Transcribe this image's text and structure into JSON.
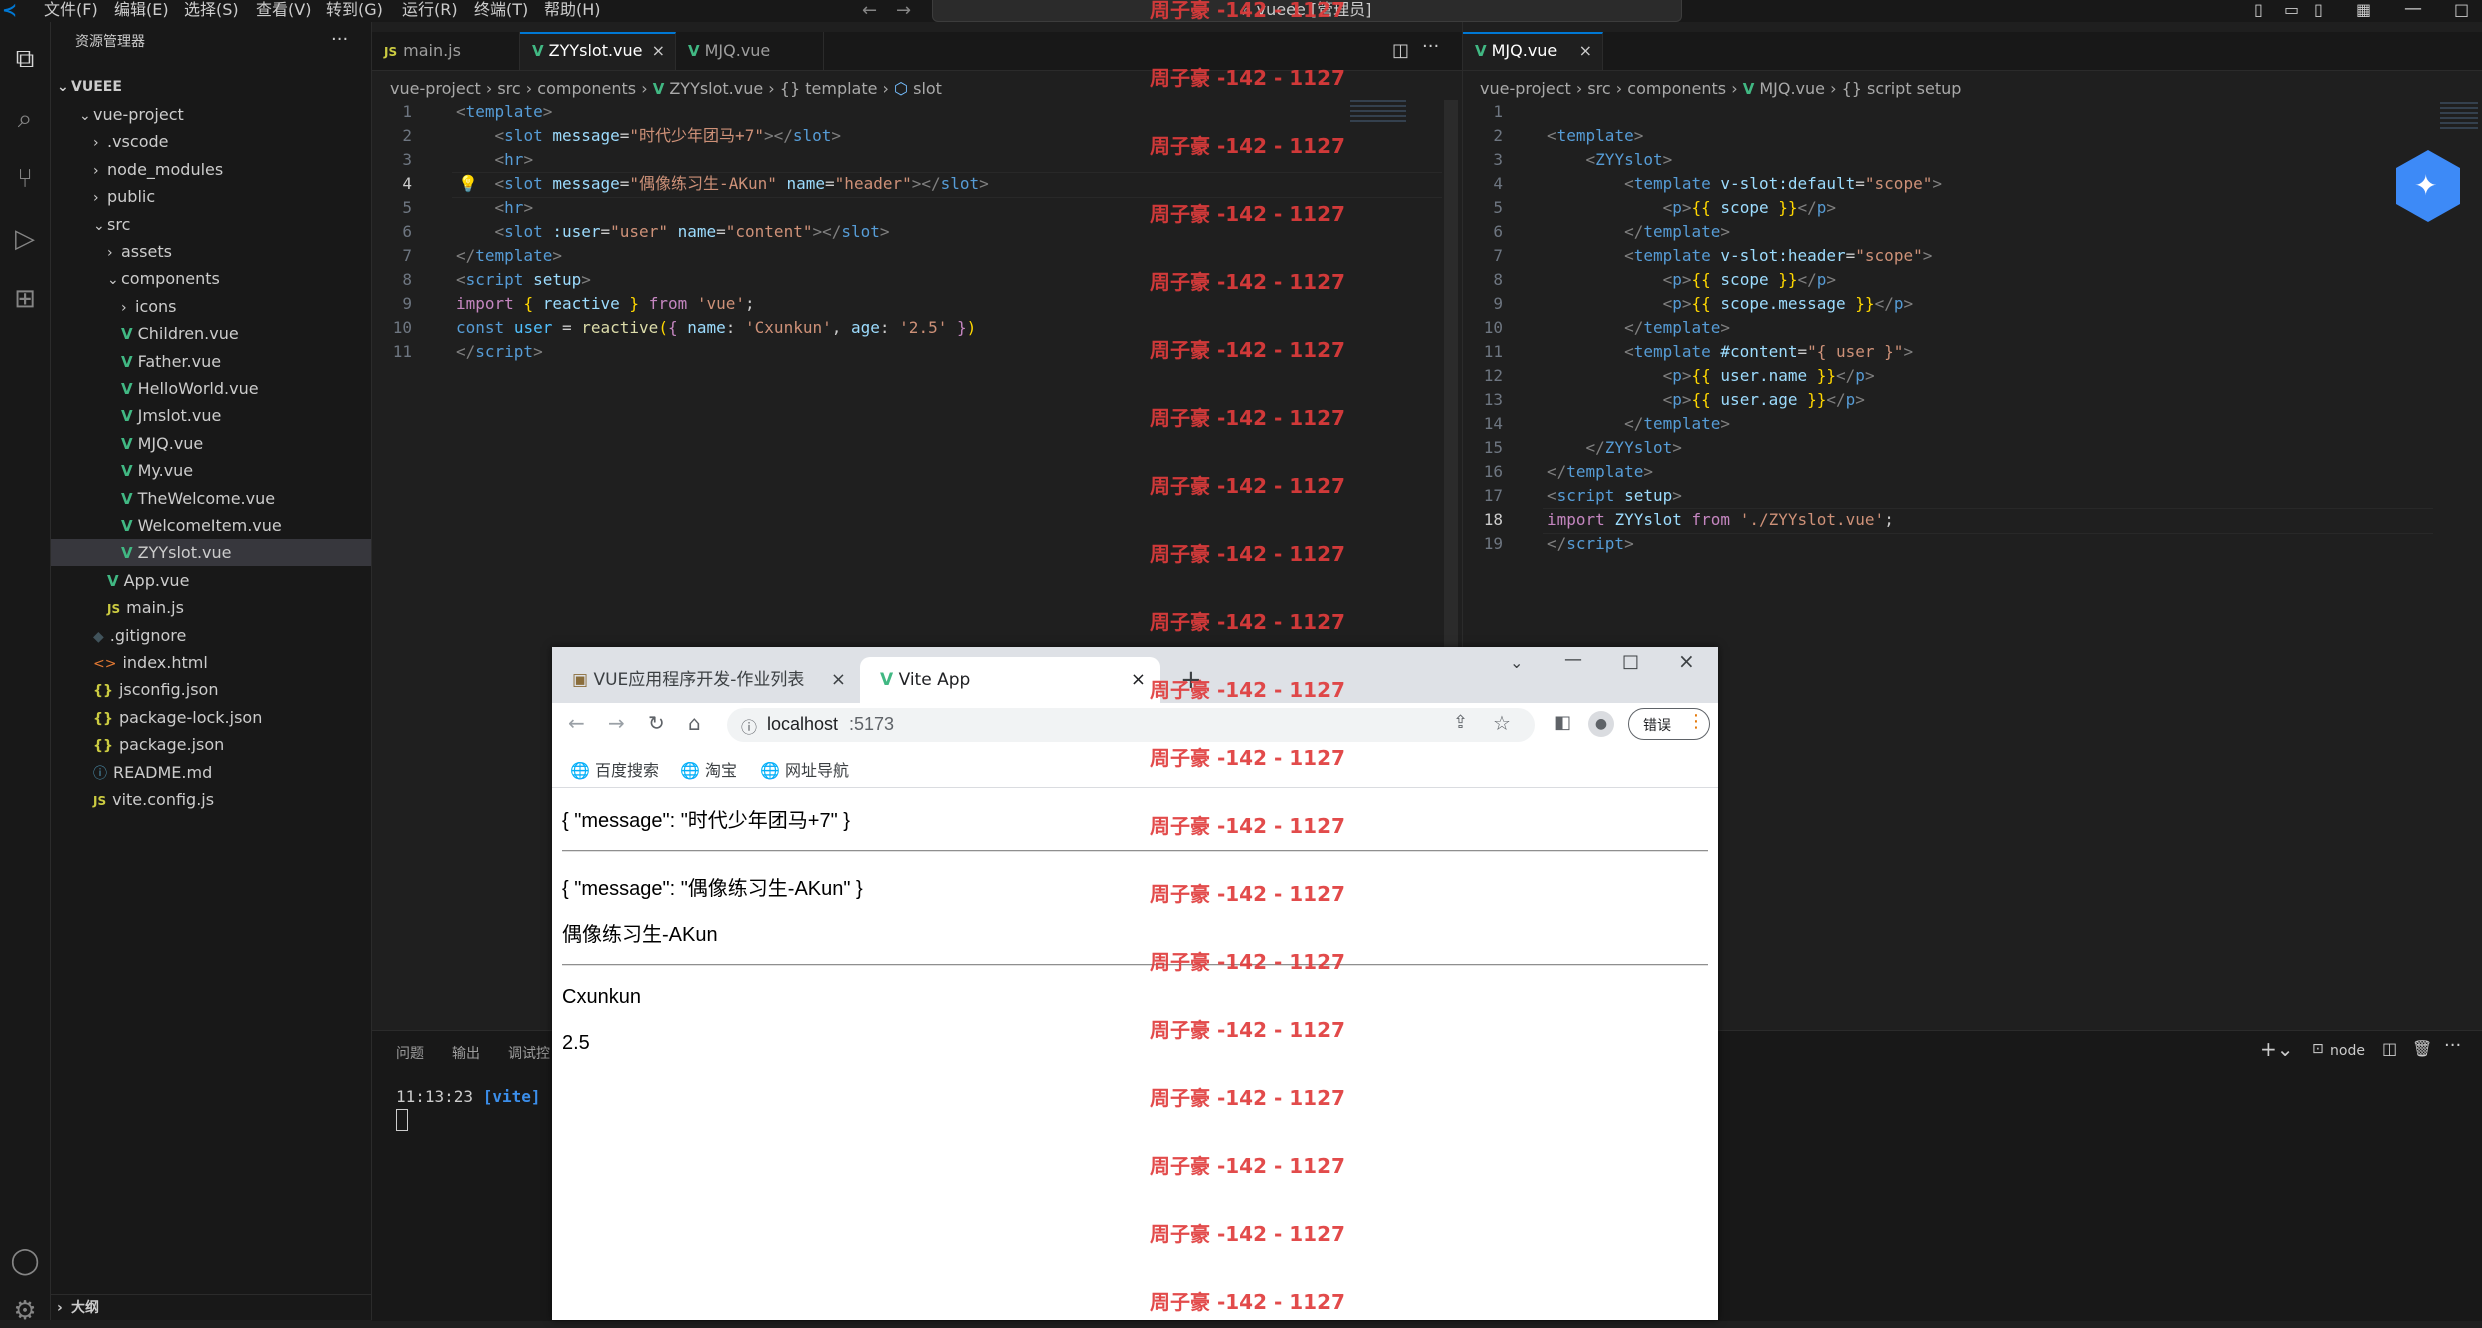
{
  "titlebar": {
    "menus": [
      "文件(F)",
      "编辑(E)",
      "选择(S)",
      "查看(V)",
      "转到(G)",
      "运行(R)",
      "终端(T)",
      "帮助(H)"
    ],
    "search_text": "vueee [管理员]"
  },
  "sidebar": {
    "header": "资源管理器",
    "root": "VUEEE",
    "items": [
      {
        "label": "vue-project",
        "kind": "folder-open",
        "depth": 1
      },
      {
        "label": ".vscode",
        "kind": "folder",
        "depth": 2
      },
      {
        "label": "node_modules",
        "kind": "folder",
        "depth": 2
      },
      {
        "label": "public",
        "kind": "folder",
        "depth": 2
      },
      {
        "label": "src",
        "kind": "folder-open",
        "depth": 2
      },
      {
        "label": "assets",
        "kind": "folder",
        "depth": 3
      },
      {
        "label": "components",
        "kind": "folder-open",
        "depth": 3
      },
      {
        "label": "icons",
        "kind": "folder",
        "depth": 4
      },
      {
        "label": "Children.vue",
        "kind": "vue",
        "depth": 4
      },
      {
        "label": "Father.vue",
        "kind": "vue",
        "depth": 4
      },
      {
        "label": "HelloWorld.vue",
        "kind": "vue",
        "depth": 4
      },
      {
        "label": "Jmslot.vue",
        "kind": "vue",
        "depth": 4
      },
      {
        "label": "MJQ.vue",
        "kind": "vue",
        "depth": 4
      },
      {
        "label": "My.vue",
        "kind": "vue",
        "depth": 4
      },
      {
        "label": "TheWelcome.vue",
        "kind": "vue",
        "depth": 4
      },
      {
        "label": "WelcomeItem.vue",
        "kind": "vue",
        "depth": 4
      },
      {
        "label": "ZYYslot.vue",
        "kind": "vue",
        "depth": 4,
        "selected": true
      },
      {
        "label": "App.vue",
        "kind": "vue",
        "depth": 3
      },
      {
        "label": "main.js",
        "kind": "js",
        "depth": 3
      },
      {
        "label": ".gitignore",
        "kind": "git",
        "depth": 2
      },
      {
        "label": "index.html",
        "kind": "html",
        "depth": 2
      },
      {
        "label": "jsconfig.json",
        "kind": "json",
        "depth": 2
      },
      {
        "label": "package-lock.json",
        "kind": "json",
        "depth": 2
      },
      {
        "label": "package.json",
        "kind": "json",
        "depth": 2
      },
      {
        "label": "README.md",
        "kind": "info",
        "depth": 2
      },
      {
        "label": "vite.config.js",
        "kind": "js",
        "depth": 2
      }
    ],
    "outline": "大纲"
  },
  "editor_left": {
    "tabs": [
      {
        "label": "main.js",
        "icon": "JS"
      },
      {
        "label": "ZYYslot.vue",
        "icon": "V",
        "active": true
      },
      {
        "label": "MJQ.vue",
        "icon": "V"
      }
    ],
    "breadcrumb": [
      "vue-project",
      "src",
      "components",
      "ZYYslot.vue",
      "{} template",
      "slot"
    ],
    "current_line": 4
  },
  "editor_right": {
    "tabs": [
      {
        "label": "MJQ.vue",
        "icon": "V",
        "active": true
      }
    ],
    "breadcrumb": [
      "vue-project",
      "src",
      "components",
      "MJQ.vue",
      "{} script setup"
    ],
    "current_line": 18
  },
  "panel": {
    "tabs": [
      "问题",
      "输出",
      "调试控"
    ],
    "terminal_time": "11:13:23",
    "terminal_tag": "[vite]",
    "terminal_rest": "(",
    "node_label": "node"
  },
  "browser": {
    "tabs": [
      {
        "label": "VUE应用程序开发-作业列表"
      },
      {
        "label": "Vite App",
        "active": true
      }
    ],
    "url_host": "localhost",
    "url_port": ":5173",
    "profile_button": "错误",
    "bookmarks": [
      "百度搜索",
      "淘宝",
      "网址导航"
    ],
    "content": {
      "line1": "{ \"message\": \"时代少年团马+7\" }",
      "line2": "{ \"message\": \"偶像练习生-AKun\" }",
      "line3": "偶像练习生-AKun",
      "line4": "Cxunkun",
      "line5": "2.5"
    }
  },
  "watermark": "周子豪 -142 - 1127",
  "colors": {
    "accent": "#0078d4",
    "vue_green": "#41b883",
    "watermark": "#e03c3c"
  }
}
